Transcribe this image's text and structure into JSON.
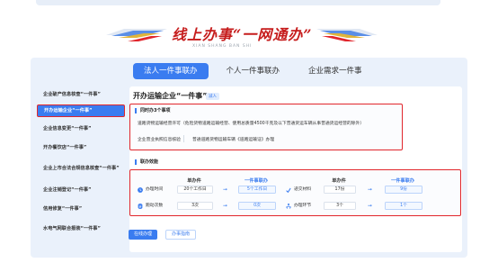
{
  "banner": {
    "title": "线上办事“一网通办”",
    "subtitle": "XIAN SHANG BAN SHI"
  },
  "tabs": [
    {
      "label": "法人一件事联办",
      "active": true
    },
    {
      "label": "个人一件事联办",
      "active": false
    },
    {
      "label": "企业需求一件事",
      "active": false
    }
  ],
  "sidebar": {
    "items": [
      {
        "label": "企业破产信息核查“一件事”",
        "active": false
      },
      {
        "label": "开办运输企业“一件事”",
        "active": true
      },
      {
        "label": "企业信息变更“一件事”",
        "active": false
      },
      {
        "label": "开办餐饮店“一件事”",
        "active": false
      },
      {
        "label": "企业上市合法合规信息核查“一件事”",
        "active": false
      },
      {
        "label": "企业注销登记“一件事”",
        "active": false
      },
      {
        "label": "信用修复“一件事”",
        "active": false
      },
      {
        "label": "水电气网联合报装“一件事”",
        "active": false
      }
    ]
  },
  "main": {
    "title": "开办运输企业“一件事”",
    "tag": "减人",
    "section1": {
      "heading": "同时办3个事项",
      "line1": "道路货物运输经营许可（危险货物道路运输经营、使用总质量4500千克及以下普通货运车辆从事普通货运经营的除外）",
      "items": [
        "企业营业执照信息核验",
        "普通道路货物运输车辆《道路运输证》办理"
      ]
    },
    "section2": {
      "heading": "联办效能",
      "header_single": "单办件",
      "header_joint": "一件事联办",
      "rows_left": [
        {
          "label": "办理时间",
          "icon": "clock-icon",
          "single": "20个工作日",
          "joint": "5个工作日"
        },
        {
          "label": "跑动次数",
          "icon": "document-icon",
          "single": "3次",
          "joint": "0次"
        }
      ],
      "rows_right": [
        {
          "label": "递交材料",
          "icon": "check-icon",
          "single": "17份",
          "joint": "9份"
        },
        {
          "label": "办理环节",
          "icon": "flow-icon",
          "single": "3个",
          "joint": "1个"
        }
      ]
    },
    "buttons": {
      "apply": "在线办理",
      "guide": "办事指南"
    }
  },
  "colors": {
    "accent": "#3a7cf0",
    "highlight": "#e1262c",
    "banner_red": "#c61c1c",
    "panel": "#eaf1fb"
  }
}
